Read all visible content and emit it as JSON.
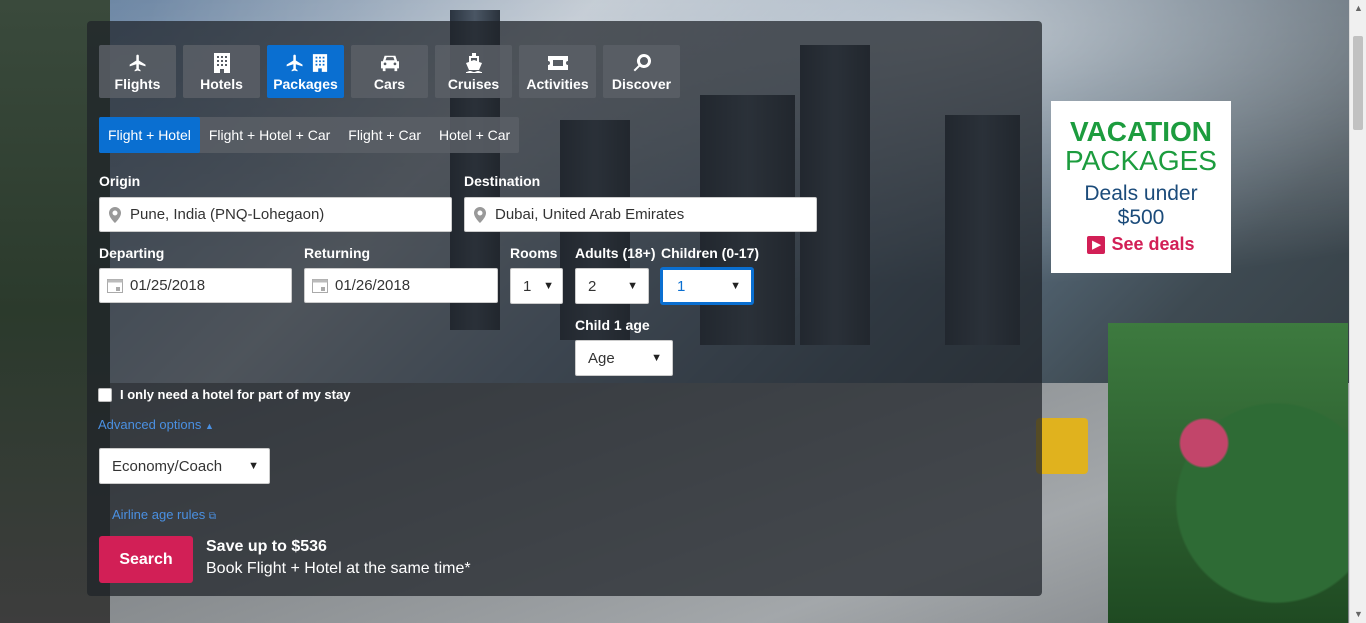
{
  "tabs": [
    {
      "label": "Flights",
      "icon": "plane-icon"
    },
    {
      "label": "Hotels",
      "icon": "building-icon"
    },
    {
      "label": "Packages",
      "icon": "plane-building-icon"
    },
    {
      "label": "Cars",
      "icon": "car-icon"
    },
    {
      "label": "Cruises",
      "icon": "ship-icon"
    },
    {
      "label": "Activities",
      "icon": "ticket-icon"
    },
    {
      "label": "Discover",
      "icon": "search-icon"
    }
  ],
  "active_tab": "Packages",
  "subtabs": [
    "Flight + Hotel",
    "Flight + Hotel + Car",
    "Flight + Car",
    "Hotel + Car"
  ],
  "active_subtab": "Flight + Hotel",
  "form": {
    "origin_label": "Origin",
    "origin_value": "Pune, India (PNQ-Lohegaon)",
    "destination_label": "Destination",
    "destination_value": "Dubai, United Arab Emirates",
    "departing_label": "Departing",
    "departing_value": "01/25/2018",
    "returning_label": "Returning",
    "returning_value": "01/26/2018",
    "rooms_label": "Rooms",
    "rooms_value": "1",
    "adults_label": "Adults (18+)",
    "adults_value": "2",
    "children_label": "Children (0-17)",
    "children_value": "1",
    "child_age_label": "Child 1 age",
    "child_age_value": "Age",
    "partial_stay_label": "I only need a hotel for part of my stay",
    "advanced_options": "Advanced options",
    "cabin_class": "Economy/Coach",
    "airline_age_rules": "Airline age rules",
    "search_label": "Search",
    "promo_title": "Save up to $536",
    "promo_sub": "Book Flight + Hotel at the same time*"
  },
  "ad": {
    "line1": "VACATION",
    "line2": "PACKAGES",
    "line3": "Deals under",
    "line4": "$500",
    "cta": "See deals"
  },
  "colors": {
    "accent": "#0a6fd1",
    "search": "#d21f56",
    "ad_green": "#1c9c3e",
    "ad_blue": "#1b4b7a"
  }
}
